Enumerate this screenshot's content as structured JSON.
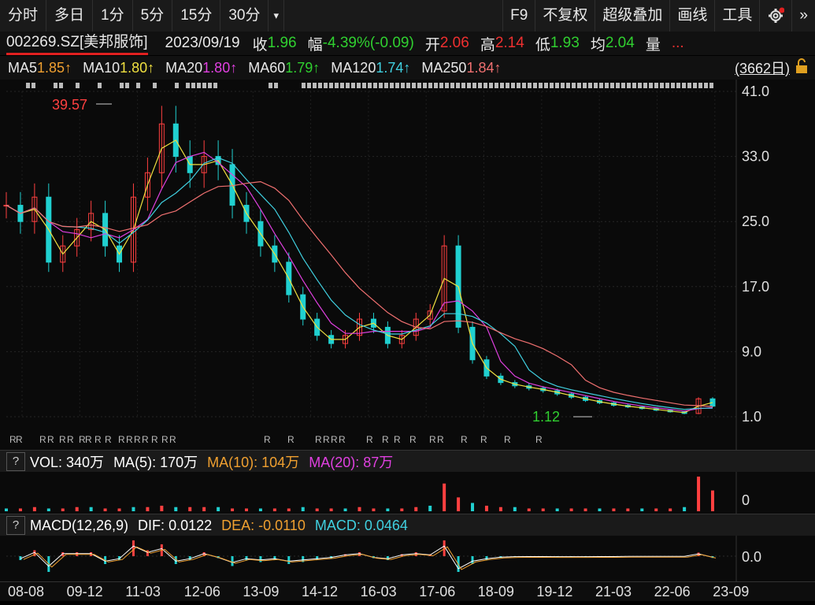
{
  "toolbar": {
    "tabs": [
      "分时",
      "多日",
      "1分",
      "5分",
      "15分",
      "30分"
    ],
    "dropdown_glyph": "▾",
    "right": [
      "F9",
      "不复权",
      "超级叠加",
      "画线",
      "工具"
    ],
    "more_glyph": "»"
  },
  "info": {
    "code": "002269.SZ[美邦服饰]",
    "date": "2023/09/19",
    "close_label": "收",
    "close": "1.96",
    "change_label": "幅",
    "change": "-4.39%(-0.09)",
    "open_label": "开",
    "open": "2.06",
    "high_label": "高",
    "high": "2.14",
    "low_label": "低",
    "low": "1.93",
    "avg_label": "均",
    "avg": "2.04",
    "vol_label": "量",
    "more": "..."
  },
  "ma_bar": {
    "items": [
      {
        "label": "MA5",
        "value": "1.85↑",
        "color": "#f0a030"
      },
      {
        "label": "MA10",
        "value": "1.80↑",
        "color": "#f0e040"
      },
      {
        "label": "MA20",
        "value": "1.80↑",
        "color": "#e040e0"
      },
      {
        "label": "MA60",
        "value": "1.79↑",
        "color": "#30d030"
      },
      {
        "label": "MA120",
        "value": "1.74↑",
        "color": "#40d0e0"
      },
      {
        "label": "MA250",
        "value": "1.84↑",
        "color": "#f07070"
      }
    ],
    "days": "(3662日)"
  },
  "chart_data": [
    {
      "type": "candlestick",
      "title": "",
      "y_ticks": [
        "41.0",
        "33.0",
        "25.0",
        "17.0",
        "9.0",
        "1.0"
      ],
      "ylim": [
        1.0,
        41.0
      ],
      "max_label": "39.57",
      "min_label": "1.12",
      "x_ticks": [
        "08-08",
        "09-12",
        "11-03",
        "12-06",
        "13-09",
        "14-12",
        "16-03",
        "17-06",
        "18-09",
        "19-12",
        "21-03",
        "22-06",
        "23-09"
      ],
      "x": [
        0,
        2,
        4,
        6,
        8,
        10,
        12,
        14,
        16,
        18,
        20,
        22,
        24,
        26,
        28,
        30,
        32,
        34,
        36,
        38,
        40,
        42,
        44,
        46,
        48,
        50,
        52,
        54,
        56,
        58,
        60,
        62,
        64,
        66,
        68,
        70,
        72,
        74,
        76,
        78,
        80,
        82,
        84,
        86,
        88,
        90,
        92,
        94,
        96,
        98,
        100
      ],
      "close": [
        27,
        25,
        28,
        20,
        22,
        24,
        26,
        22,
        20,
        28,
        31,
        37,
        33,
        31,
        33,
        32,
        27,
        25,
        22,
        20,
        16,
        13,
        11,
        10,
        11,
        13,
        12,
        10,
        11,
        13,
        14,
        22,
        12,
        8,
        6,
        5.2,
        4.8,
        4.5,
        4.2,
        3.8,
        3.4,
        3.0,
        2.7,
        2.4,
        2.2,
        2.0,
        1.8,
        1.6,
        1.4,
        3.2,
        2.3
      ]
    },
    {
      "type": "bar",
      "title": "VOL: 340万",
      "series": [
        {
          "name": "VOL",
          "value": "340万",
          "color": "#ffffff"
        },
        {
          "name": "MA(5)",
          "value": "170万",
          "color": "#ffffff"
        },
        {
          "name": "MA(10)",
          "value": "104万",
          "color": "#f0a030"
        },
        {
          "name": "MA(20)",
          "value": "87万",
          "color": "#e040e0"
        }
      ],
      "y_ticks": [
        "0"
      ],
      "values": [
        2,
        2,
        3,
        2,
        2,
        3,
        3,
        2,
        2,
        3,
        3,
        4,
        3,
        3,
        3,
        3,
        2,
        2,
        2,
        2,
        2,
        3,
        2,
        2,
        2,
        3,
        2,
        2,
        2,
        3,
        4,
        20,
        10,
        6,
        4,
        3,
        3,
        2,
        2,
        2,
        2,
        2,
        2,
        2,
        2,
        2,
        2,
        2,
        3,
        25,
        15
      ]
    },
    {
      "type": "line",
      "title": "MACD(12,26,9)",
      "series": [
        {
          "name": "DIF",
          "value": "0.0122",
          "color": "#ffffff"
        },
        {
          "name": "DEA",
          "value": "-0.0110",
          "color": "#f0a030"
        },
        {
          "name": "MACD",
          "value": "0.0464",
          "color": "#40d0e0"
        }
      ],
      "y_ticks": [
        "0.0"
      ]
    }
  ]
}
